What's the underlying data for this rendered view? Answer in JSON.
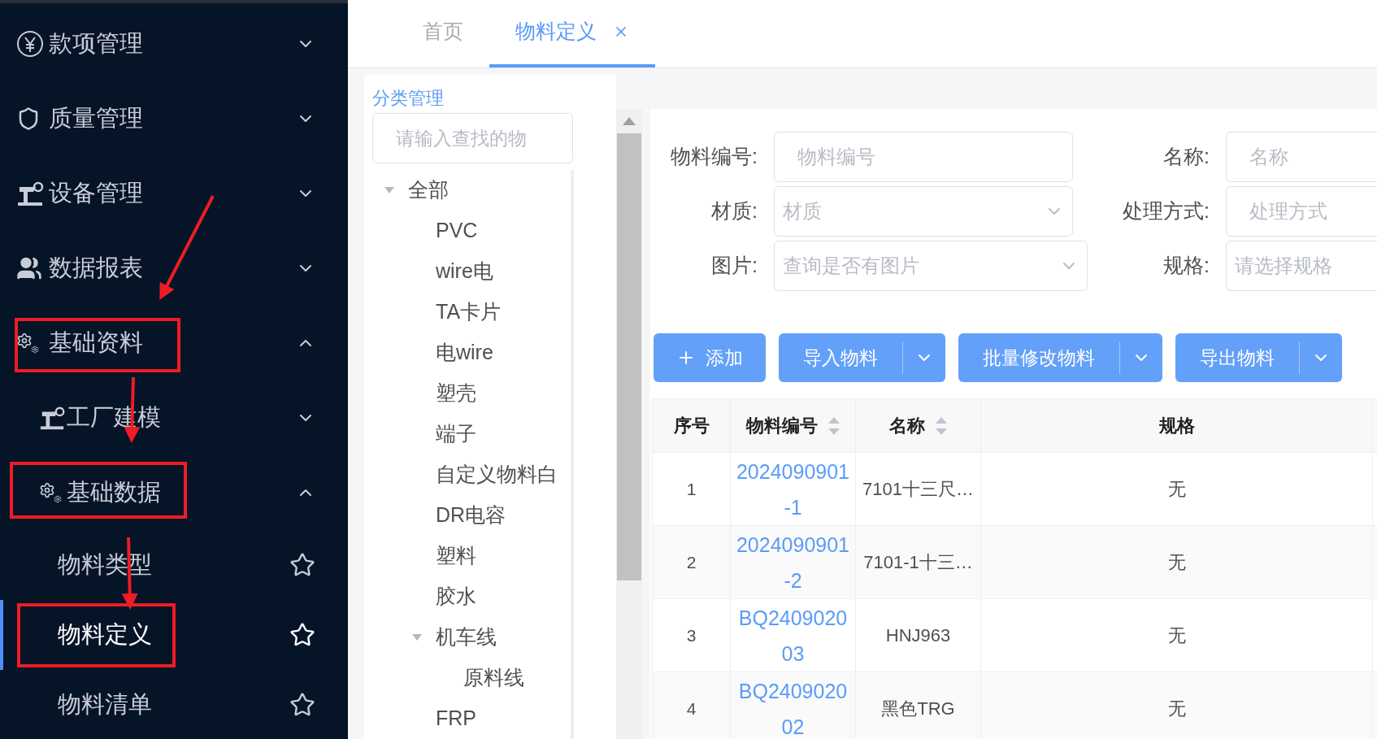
{
  "sidebar": {
    "items": [
      {
        "label": "款项管理",
        "expanded": false
      },
      {
        "label": "质量管理",
        "expanded": false
      },
      {
        "label": "设备管理",
        "expanded": false
      },
      {
        "label": "数据报表",
        "expanded": false
      },
      {
        "label": "基础资料",
        "expanded": true,
        "children": [
          {
            "label": "工厂建模",
            "expanded": false
          },
          {
            "label": "基础数据",
            "expanded": true,
            "children": [
              {
                "label": "物料类型",
                "selected": false
              },
              {
                "label": "物料定义",
                "selected": true
              },
              {
                "label": "物料清单",
                "selected": false
              }
            ]
          }
        ]
      }
    ]
  },
  "tabs": [
    {
      "label": "首页",
      "selected": false,
      "closable": false
    },
    {
      "label": "物料定义",
      "selected": true,
      "closable": true
    }
  ],
  "category_panel": {
    "title": "分类管理",
    "search": {
      "placeholder": "请输入查找的物"
    },
    "tree": [
      {
        "label": "全部",
        "expanded": true,
        "children": [
          {
            "label": "PVC"
          },
          {
            "label": "wire电"
          },
          {
            "label": "TA卡片"
          },
          {
            "label": "电wire"
          },
          {
            "label": "塑壳"
          },
          {
            "label": "端子"
          },
          {
            "label": "自定义物料白"
          },
          {
            "label": "DR电容"
          },
          {
            "label": "塑料"
          },
          {
            "label": "胶水"
          },
          {
            "label": "机车线",
            "expanded": true,
            "children": [
              {
                "label": "原料线"
              }
            ]
          },
          {
            "label": "FRP"
          }
        ]
      }
    ]
  },
  "filters": [
    [
      {
        "label": "物料编号:",
        "kind": "input",
        "placeholder": "物料编号"
      },
      {
        "label": "名称:",
        "kind": "input",
        "placeholder": "名称"
      }
    ],
    [
      {
        "label": "材质:",
        "kind": "select",
        "placeholder": "材质"
      },
      {
        "label": "处理方式:",
        "kind": "input",
        "placeholder": "处理方式"
      }
    ],
    [
      {
        "label": "图片:",
        "kind": "select",
        "placeholder": "查询是否有图片"
      },
      {
        "label": "规格:",
        "kind": "input",
        "placeholder": "请选择规格"
      }
    ]
  ],
  "toolbar": [
    {
      "label": "添加",
      "kind": "add"
    },
    {
      "label": "导入物料",
      "kind": "split"
    },
    {
      "label": "批量修改物料",
      "kind": "split"
    },
    {
      "label": "导出物料",
      "kind": "split"
    }
  ],
  "table": {
    "columns": [
      {
        "label": "序号",
        "sortable": false
      },
      {
        "label": "物料编号",
        "sortable": true
      },
      {
        "label": "名称",
        "sortable": true
      },
      {
        "label": "规格",
        "sortable": false
      }
    ],
    "rows": [
      [
        "1",
        "2024090901-1",
        "7101十三尺…",
        "无"
      ],
      [
        "2",
        "2024090901-2",
        "7101-1十三…",
        "无"
      ],
      [
        "3",
        "BQ240902003",
        "HNJ963",
        "无"
      ],
      [
        "4",
        "BQ240902002",
        "黑色TRG",
        "无"
      ]
    ]
  }
}
